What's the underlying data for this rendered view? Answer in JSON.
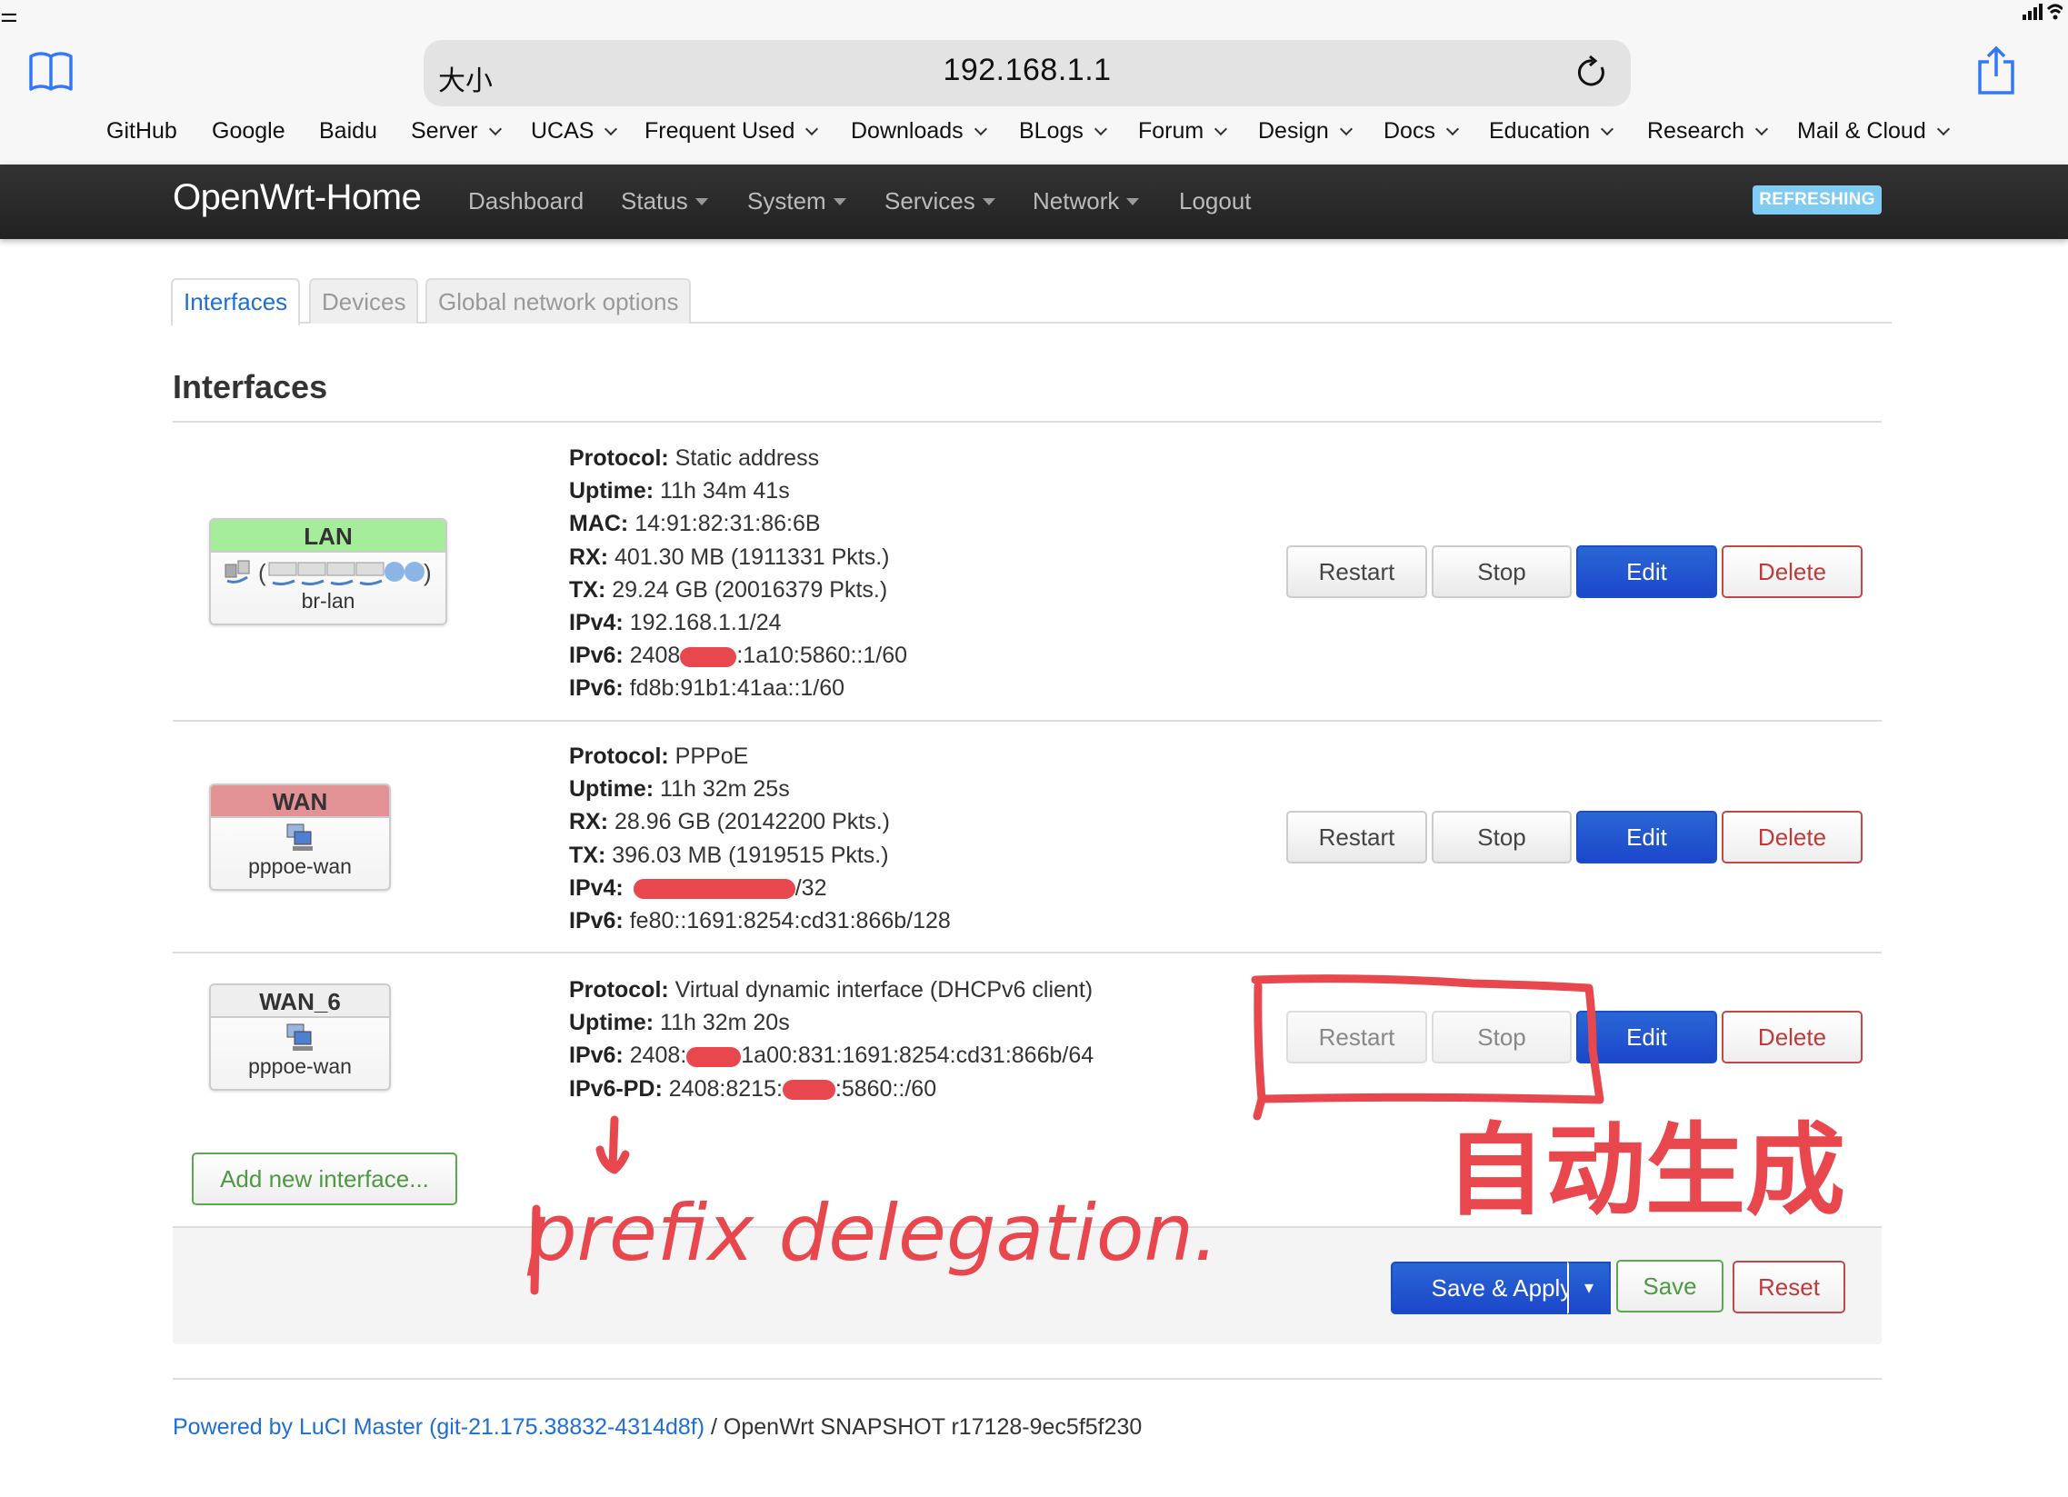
{
  "browser": {
    "address_bar": {
      "text_size_label": "大小",
      "url": "192.168.1.1"
    },
    "bookmarks": [
      {
        "label": "GitHub",
        "has_menu": false
      },
      {
        "label": "Google",
        "has_menu": false
      },
      {
        "label": "Baidu",
        "has_menu": false
      },
      {
        "label": "Server",
        "has_menu": true
      },
      {
        "label": "UCAS",
        "has_menu": true
      },
      {
        "label": "Frequent Used",
        "has_menu": true
      },
      {
        "label": "Downloads",
        "has_menu": true
      },
      {
        "label": "BLogs",
        "has_menu": true
      },
      {
        "label": "Forum",
        "has_menu": true
      },
      {
        "label": "Design",
        "has_menu": true
      },
      {
        "label": "Docs",
        "has_menu": true
      },
      {
        "label": "Education",
        "has_menu": true
      },
      {
        "label": "Research",
        "has_menu": true
      },
      {
        "label": "Mail & Cloud",
        "has_menu": true
      }
    ],
    "accent_color": "#3478f6"
  },
  "navbar": {
    "brand": "OpenWrt-Home",
    "items": [
      {
        "label": "Dashboard",
        "has_menu": false
      },
      {
        "label": "Status",
        "has_menu": true
      },
      {
        "label": "System",
        "has_menu": true
      },
      {
        "label": "Services",
        "has_menu": true
      },
      {
        "label": "Network",
        "has_menu": true
      },
      {
        "label": "Logout",
        "has_menu": false
      }
    ],
    "status_badge": "REFRESHING"
  },
  "tabs": [
    {
      "label": "Interfaces",
      "active": true
    },
    {
      "label": "Devices",
      "active": false
    },
    {
      "label": "Global network options",
      "active": false
    }
  ],
  "section_title": "Interfaces",
  "interfaces": [
    {
      "name": "LAN",
      "header_color": "#a5ec9b",
      "device": "br-lan",
      "details": [
        {
          "label": "Protocol:",
          "value": "Static address"
        },
        {
          "label": "Uptime:",
          "value": "11h 34m 41s"
        },
        {
          "label": "MAC:",
          "value": "14:91:82:31:86:6B"
        },
        {
          "label": "RX:",
          "value": "401.30 MB (1911331 Pkts.)"
        },
        {
          "label": "TX:",
          "value": "29.24 GB (20016379 Pkts.)"
        },
        {
          "label": "IPv4:",
          "value": "192.168.1.1/24"
        },
        {
          "label": "IPv6:",
          "value_before_redaction": "2408",
          "value_after_redaction": ":1a10:5860::1/60"
        },
        {
          "label": "IPv6:",
          "value": "fd8b:91b1:41aa::1/60"
        }
      ],
      "buttons": {
        "restart": "Restart",
        "stop": "Stop",
        "edit": "Edit",
        "delete": "Delete"
      },
      "restart_stop_disabled": false
    },
    {
      "name": "WAN",
      "header_color": "#e29294",
      "device": "pppoe-wan",
      "details": [
        {
          "label": "Protocol:",
          "value": "PPPoE"
        },
        {
          "label": "Uptime:",
          "value": "11h 32m 25s"
        },
        {
          "label": "RX:",
          "value": "28.96 GB (20142200 Pkts.)"
        },
        {
          "label": "TX:",
          "value": "396.03 MB (1919515 Pkts.)"
        },
        {
          "label": "IPv4:",
          "value_before_redaction": "",
          "value_after_redaction": "/32"
        },
        {
          "label": "IPv6:",
          "value": "fe80::1691:8254:cd31:866b/128"
        }
      ],
      "buttons": {
        "restart": "Restart",
        "stop": "Stop",
        "edit": "Edit",
        "delete": "Delete"
      },
      "restart_stop_disabled": false
    },
    {
      "name": "WAN_6",
      "header_color": "#eeeeee",
      "device": "pppoe-wan",
      "details": [
        {
          "label": "Protocol:",
          "value": "Virtual dynamic interface (DHCPv6 client)"
        },
        {
          "label": "Uptime:",
          "value": "11h 32m 20s"
        },
        {
          "label": "IPv6:",
          "value_before_redaction": "2408:",
          "value_after_redaction": "1a00:831:1691:8254:cd31:866b/64"
        },
        {
          "label": "IPv6-PD:",
          "value_before_redaction": "2408:8215:",
          "value_after_redaction": ":5860::/60"
        }
      ],
      "buttons": {
        "restart": "Restart",
        "stop": "Stop",
        "edit": "Edit",
        "delete": "Delete"
      },
      "restart_stop_disabled": true
    }
  ],
  "add_interface_label": "Add new interface...",
  "actions": {
    "save_apply": "Save & Apply",
    "dropdown": "▾",
    "save": "Save",
    "reset": "Reset"
  },
  "footer": {
    "link_text": "Powered by LuCI Master (git-21.175.38832-4314d8f)",
    "rest_text": " / OpenWrt SNAPSHOT r17128-9ec5f5f230"
  },
  "annotations": {
    "color": "#e8474e",
    "prefix_note": "prefix delegation.",
    "auto_note": "自动生成"
  }
}
